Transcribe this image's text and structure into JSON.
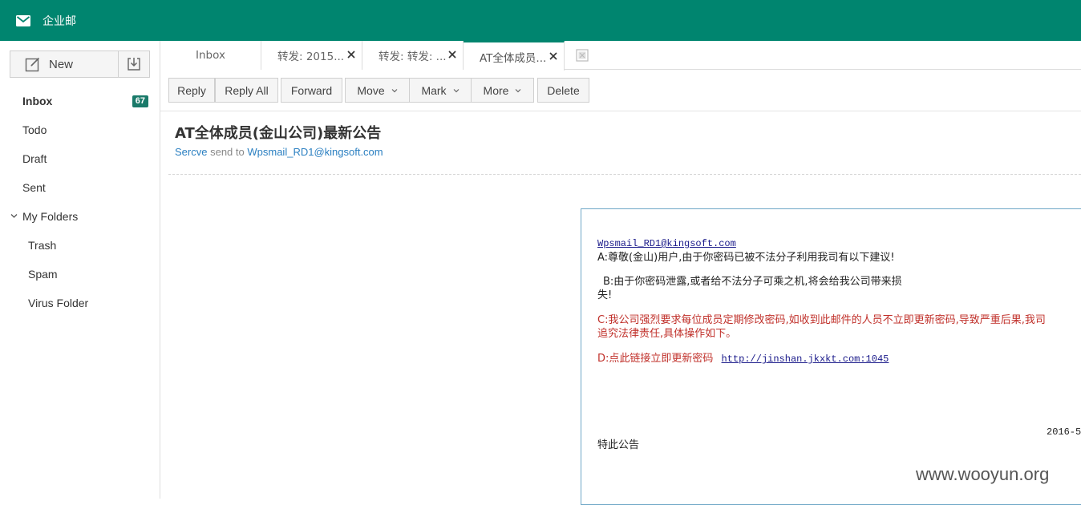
{
  "app": {
    "title": "企业邮"
  },
  "sidebar": {
    "new_label": "New",
    "items": [
      {
        "label": "Inbox",
        "badge": "67"
      },
      {
        "label": "Todo"
      },
      {
        "label": "Draft"
      },
      {
        "label": "Sent"
      },
      {
        "label": "My Folders"
      },
      {
        "label": "Trash"
      },
      {
        "label": "Spam"
      },
      {
        "label": "Virus Folder"
      }
    ]
  },
  "tabs": [
    {
      "label": "Inbox"
    },
    {
      "label": "转发: 2015..."
    },
    {
      "label": "转发: 转发: ..."
    },
    {
      "label": "AT全体成员..."
    }
  ],
  "toolbar": {
    "reply": "Reply",
    "reply_all": "Reply All",
    "forward": "Forward",
    "move": "Move",
    "mark": "Mark",
    "more": "More",
    "delete": "Delete"
  },
  "message": {
    "subject": "AT全体成员(金山公司)最新公告",
    "sender": "Sercve",
    "send_to_text": "send to",
    "recipient": "Wpsmail_RD1@kingsoft.com",
    "body": {
      "to_link": "Wpsmail_RD1@kingsoft.com",
      "line_a": "A:尊敬(金山)用户,由于你密码已被不法分子利用我司有以下建议!",
      "line_b1": "B:由于你密码泄露,或者给不法分子可乘之机,将会给我公司带来损",
      "line_b2": "失!",
      "line_c1": "C:我公司强烈要求每位成员定期修改密码,如收到此邮件的人员不立即更新密码,导致严重后果,我司",
      "line_c2": "追究法律责任,具体操作如下。",
      "line_d": "D:点此链接立即更新密码",
      "phish_link": "http://jinshan.jkxkt.com:1045",
      "date": "2016-5",
      "closing": "特此公告"
    }
  },
  "watermark": "www.wooyun.org",
  "colors": {
    "brand": "#00856f",
    "link": "#2a7fc1",
    "alert_red": "#c0302a"
  }
}
